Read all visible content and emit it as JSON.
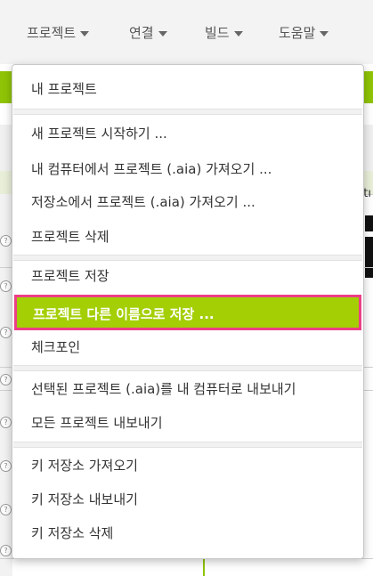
{
  "topnav": {
    "items": [
      {
        "label": "프로젝트"
      },
      {
        "label": "연결"
      },
      {
        "label": "빌드"
      },
      {
        "label": "도움말"
      }
    ]
  },
  "background": {
    "right_label": "tı",
    "help_icon_glyph": "?"
  },
  "colors": {
    "accent_green": "#a4cf05",
    "highlight_border": "#ec3f86",
    "nav_bg": "#f3f3f3"
  },
  "menu": {
    "groups": [
      [
        {
          "label": "내 프로젝트"
        }
      ],
      [
        {
          "label": "새 프로젝트 시작하기 ..."
        },
        {
          "label": "내 컴퓨터에서 프로젝트 (.aia) 가져오기 ..."
        },
        {
          "label": "저장소에서 프로젝트 (.aia) 가져오기 ..."
        },
        {
          "label": "프로젝트 삭제"
        }
      ],
      [
        {
          "label": "프로젝트 저장"
        },
        {
          "label": "프로젝트 다른 이름으로 저장 ...",
          "highlighted": true
        },
        {
          "label": "체크포인"
        }
      ],
      [
        {
          "label": "선택된 프로젝트 (.aia)를 내 컴퓨터로 내보내기"
        },
        {
          "label": "모든 프로젝트 내보내기"
        }
      ],
      [
        {
          "label": "키 저장소 가져오기"
        },
        {
          "label": "키 저장소 내보내기"
        },
        {
          "label": "키 저장소 삭제"
        }
      ]
    ]
  }
}
